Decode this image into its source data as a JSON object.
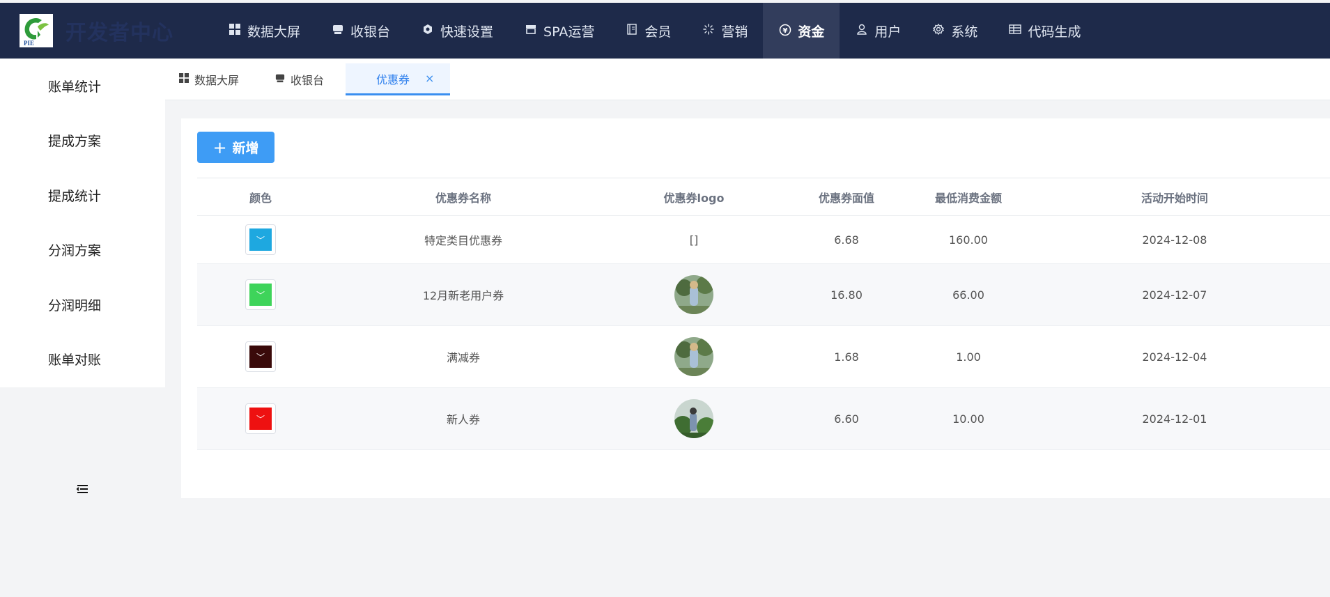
{
  "app": {
    "logo_text": "PIE",
    "title": "开发者中心"
  },
  "nav": [
    {
      "label": "数据大屏",
      "icon": "grid-icon",
      "active": false
    },
    {
      "label": "收银台",
      "icon": "store-icon",
      "active": false
    },
    {
      "label": "快速设置",
      "icon": "hexagon-icon",
      "active": false
    },
    {
      "label": "SPA运营",
      "icon": "shop-icon",
      "active": false
    },
    {
      "label": "会员",
      "icon": "book-icon",
      "active": false
    },
    {
      "label": "营销",
      "icon": "loading-icon",
      "active": false
    },
    {
      "label": "资金",
      "icon": "yen-icon",
      "active": true
    },
    {
      "label": "用户",
      "icon": "user-icon",
      "active": false
    },
    {
      "label": "系统",
      "icon": "gear-icon",
      "active": false
    },
    {
      "label": "代码生成",
      "icon": "table-icon",
      "active": false
    }
  ],
  "sidebar": {
    "items": [
      {
        "label": "账单统计"
      },
      {
        "label": "提成方案"
      },
      {
        "label": "提成统计"
      },
      {
        "label": "分润方案"
      },
      {
        "label": "分润明细"
      },
      {
        "label": "账单对账"
      }
    ]
  },
  "tabs": [
    {
      "label": "数据大屏",
      "icon": "grid-icon"
    },
    {
      "label": "收银台",
      "icon": "store-icon"
    },
    {
      "label": "优惠券",
      "active": true,
      "close": "×"
    }
  ],
  "toolbar": {
    "add_icon": "+",
    "add_label": "新增"
  },
  "table": {
    "headers": [
      "颜色",
      "优惠券名称",
      "优惠券logo",
      "优惠券面值",
      "最低消费金额",
      "活动开始时间"
    ],
    "rows": [
      {
        "color": "#1ea8e0",
        "name": "特定类目优惠券",
        "logo": "[]",
        "face_value": "6.68",
        "min_spend": "160.00",
        "start_date": "2024-12-08"
      },
      {
        "color": "#3ed45a",
        "name": "12月新老用户券",
        "logo": "image",
        "face_value": "16.80",
        "min_spend": "66.00",
        "start_date": "2024-12-07"
      },
      {
        "color": "#3a0a0a",
        "name": "满减券",
        "logo": "image",
        "face_value": "1.68",
        "min_spend": "1.00",
        "start_date": "2024-12-04"
      },
      {
        "color": "#ee1111",
        "name": "新人券",
        "logo": "image",
        "face_value": "6.60",
        "min_spend": "10.00",
        "start_date": "2024-12-01"
      }
    ]
  }
}
